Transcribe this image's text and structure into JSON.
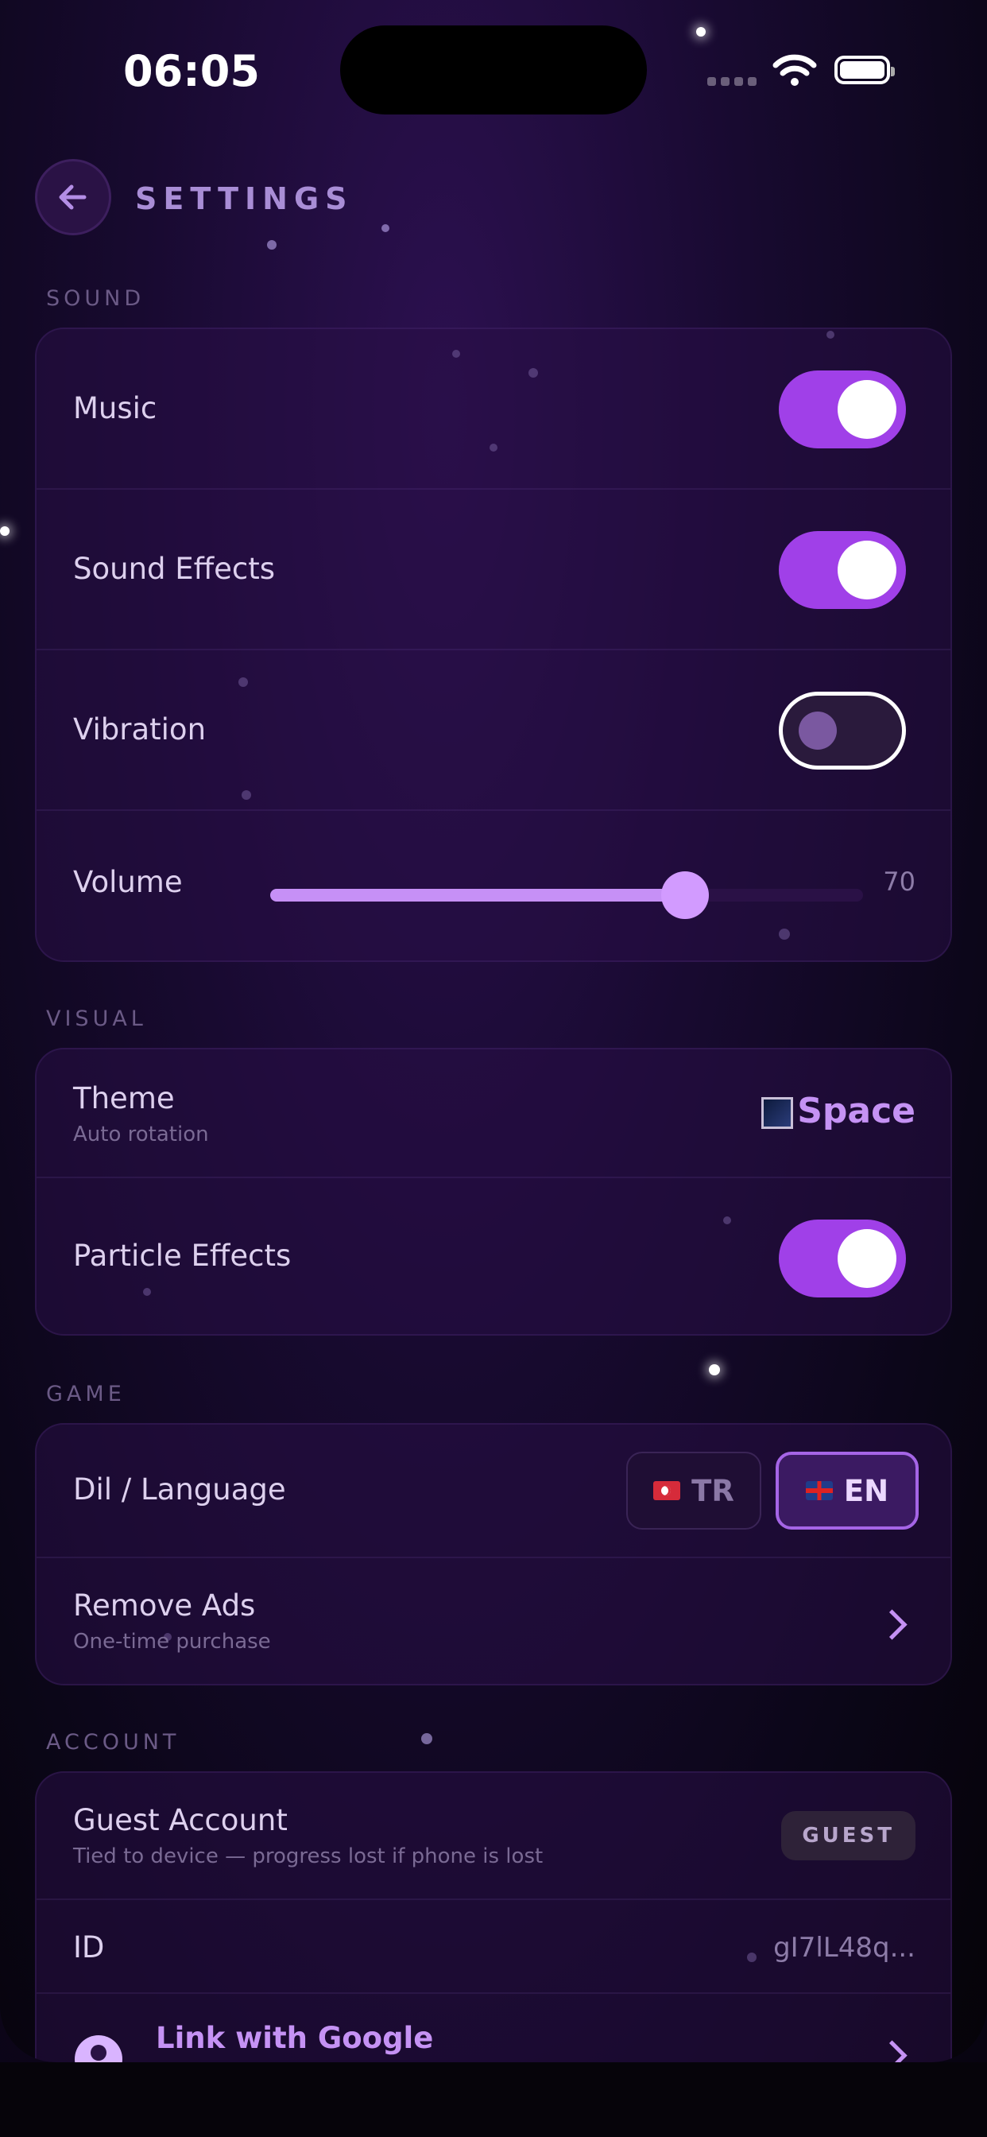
{
  "status_bar": {
    "time": "06:05"
  },
  "header": {
    "title": "SETTINGS"
  },
  "sections": {
    "sound": "SOUND",
    "visual": "VISUAL",
    "game": "GAME",
    "account": "ACCOUNT"
  },
  "sound": {
    "music": {
      "label": "Music",
      "enabled": true
    },
    "sound_effects": {
      "label": "Sound Effects",
      "enabled": true
    },
    "vibration": {
      "label": "Vibration",
      "enabled": false
    },
    "volume": {
      "label": "Volume",
      "value": "70",
      "fraction": 0.7
    }
  },
  "visual": {
    "theme": {
      "label": "Theme",
      "sublabel": "Auto rotation",
      "value": "Space"
    },
    "particle_effects": {
      "label": "Particle Effects",
      "enabled": true
    }
  },
  "game": {
    "language": {
      "label": "Dil / Language",
      "options": [
        "TR",
        "EN"
      ],
      "selected": "EN"
    },
    "remove_ads": {
      "label": "Remove Ads",
      "sublabel": "One-time purchase"
    }
  },
  "account": {
    "guest": {
      "label": "Guest Account",
      "sublabel": "Tied to device — progress lost if phone is lost",
      "badge": "GUEST"
    },
    "id": {
      "label": "ID",
      "value": "gI7lL48q..."
    },
    "google": {
      "label": "Link with Google"
    }
  },
  "colors": {
    "accent": "#a040e8",
    "accent_light": "#c592f4",
    "background": "#14072a"
  },
  "icons": [
    "back-arrow-icon",
    "wifi-icon",
    "battery-icon",
    "theme-image-icon",
    "flag-tr-icon",
    "flag-gb-icon",
    "chevron-right-icon",
    "person-icon"
  ]
}
